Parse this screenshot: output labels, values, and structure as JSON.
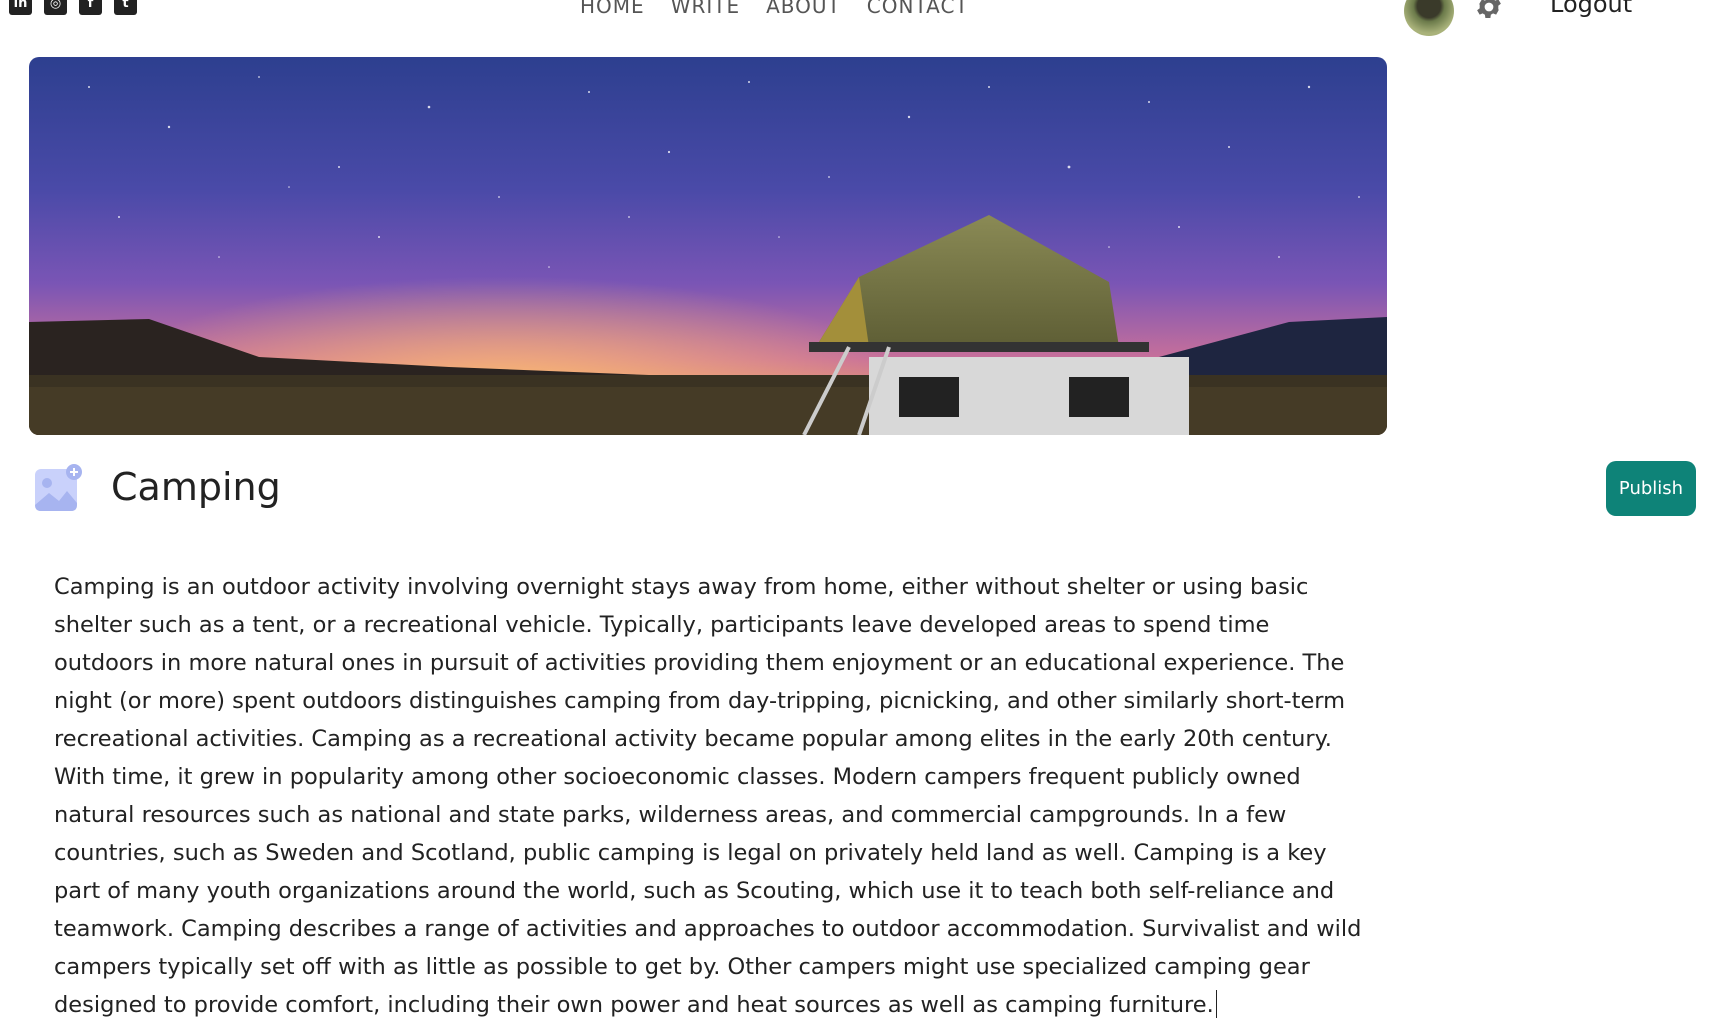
{
  "social": [
    {
      "name": "linkedin-icon",
      "glyph": "in"
    },
    {
      "name": "instagram-icon",
      "glyph": "◎"
    },
    {
      "name": "facebook-icon",
      "glyph": "f"
    },
    {
      "name": "twitter-icon",
      "glyph": "t"
    }
  ],
  "nav": {
    "home": "HOME",
    "write": "WRITE",
    "about": "ABOUT",
    "contact": "CONTACT"
  },
  "user": {
    "logout_label": "Logout"
  },
  "editor": {
    "title": "Camping",
    "publish_label": "Publish",
    "body": "Camping is an outdoor activity involving overnight stays away from home, either without shelter or using basic shelter such as a tent, or a recreational vehicle. Typically, participants leave developed areas to spend time outdoors in more natural ones in pursuit of activities providing them enjoyment or an educational experience. The night (or more) spent outdoors distinguishes camping from day-tripping, picnicking, and other similarly short-term recreational activities. Camping as a recreational activity became popular among elites in the early 20th century. With time, it grew in popularity among other socioeconomic classes. Modern campers frequent publicly owned natural resources such as national and state parks, wilderness areas, and commercial campgrounds. In a few countries, such as Sweden and Scotland, public camping is legal on privately held land as well. Camping is a key part of many youth organizations around the world, such as Scouting, which use it to teach both self-reliance and teamwork. Camping describes a range of activities and approaches to outdoor accommodation. Survivalist and wild campers typically set off with as little as possible to get by. Other campers might use specialized camping gear designed to provide comfort, including their own power and heat sources as well as camping furniture."
  },
  "colors": {
    "publish_bg": "#0e8378",
    "add_image_icon": "#a7b4f0"
  }
}
